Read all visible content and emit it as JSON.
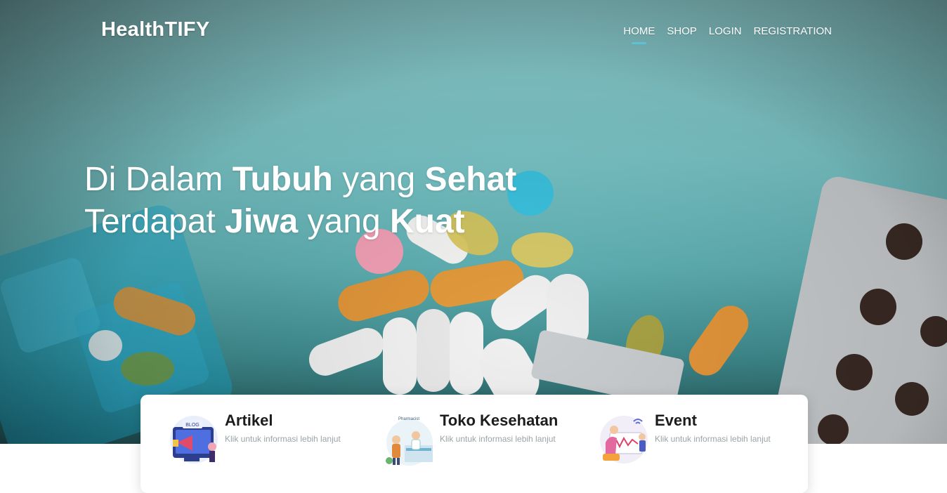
{
  "brand": "HealthTIFY",
  "nav": [
    {
      "label": "HOME",
      "active": true
    },
    {
      "label": "SHOP",
      "active": false
    },
    {
      "label": "LOGIN",
      "active": false
    },
    {
      "label": "REGISTRATION",
      "active": false
    }
  ],
  "hero": {
    "line1": {
      "w1": "Di Dalam",
      "w2": "Tubuh",
      "w3": "yang",
      "w4": "Sehat"
    },
    "line2": {
      "w1": "Terdapat",
      "w2": "Jiwa",
      "w3": "yang",
      "w4": "Kuat"
    }
  },
  "cards": [
    {
      "title": "Artikel",
      "subtitle": "Klik untuk informasi lebih lanjut",
      "icon": "blog-icon",
      "icon_text": "BLOG"
    },
    {
      "title": "Toko Kesehatan",
      "subtitle": "Klik untuk informasi lebih lanjut",
      "icon": "pharmacy-icon",
      "icon_text": "Pharmacist"
    },
    {
      "title": "Event",
      "subtitle": "Klik untuk informasi lebih lanjut",
      "icon": "event-icon"
    }
  ],
  "colors": {
    "accent": "#5cc3d6",
    "hero_bg": "#7cc7c9"
  }
}
